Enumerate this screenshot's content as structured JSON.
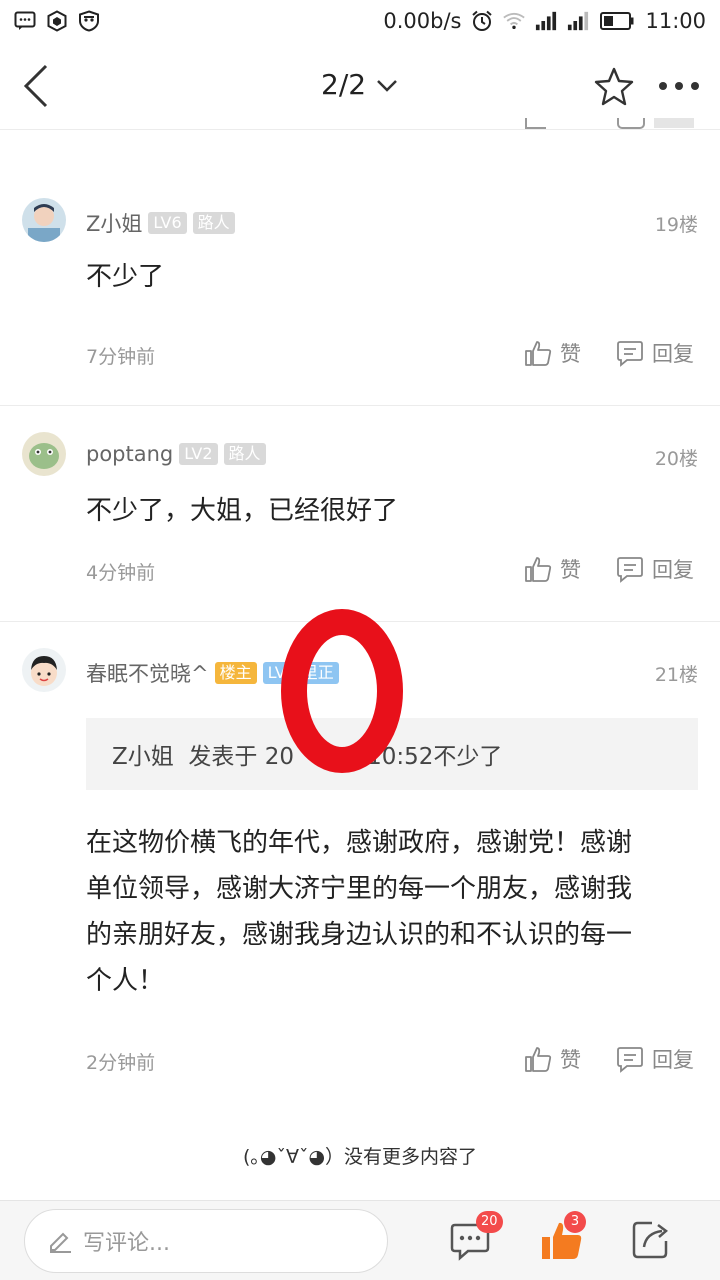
{
  "status_bar": {
    "speed": "0.00b/s",
    "time": "11:00",
    "icons": [
      "message-icon",
      "hexagon-icon",
      "shield-icon",
      "alarm-icon",
      "wifi-icon",
      "signal-icon",
      "signal-icon",
      "battery-icon"
    ]
  },
  "nav": {
    "page_indicator": "2/2"
  },
  "comments": [
    {
      "user": "Z小姐",
      "level": "LV6",
      "title": "路人",
      "floor": "19楼",
      "content": "不少了",
      "time": "7分钟前",
      "like_label": "赞",
      "reply_label": "回复"
    },
    {
      "user": "poptang",
      "level": "LV2",
      "title": "路人",
      "floor": "20楼",
      "content": "不少了，大姐，已经很好了",
      "time": "4分钟前",
      "like_label": "赞",
      "reply_label": "回复"
    },
    {
      "user": "春眠不觉晓^",
      "owner_badge": "楼主",
      "level": "LV",
      "title": "里正",
      "floor": "21楼",
      "quote": "Z小姐  发表于 20     31 10:52不少了",
      "content": "在这物价横飞的年代，感谢政府，感谢党！感谢单位领导，感谢大济宁里的每一个朋友，感谢我的亲朋好友，感谢我身边认识的和不认识的每一个人！",
      "time": "2分钟前",
      "like_label": "赞",
      "reply_label": "回复"
    }
  ],
  "footer_note": "(｡◕ˇ∀ˇ◕）没有更多内容了",
  "bottom_bar": {
    "comment_placeholder": "写评论...",
    "comment_count": "20",
    "like_count": "3"
  },
  "colors": {
    "annotation_ring": "#e8101a",
    "owner_badge": "#f5b63c",
    "title_badge": "#8ec5f2",
    "like_active": "#f47b20"
  }
}
